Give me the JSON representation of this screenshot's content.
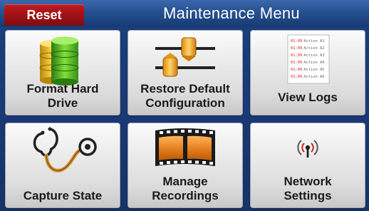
{
  "header": {
    "reset_label": "Reset",
    "title": "Maintenance Menu"
  },
  "tiles": [
    {
      "label_lines": [
        "Format Hard",
        "Drive"
      ],
      "icon": "database-icon"
    },
    {
      "label_lines": [
        "Restore Default",
        "Configuration"
      ],
      "icon": "sliders-icon"
    },
    {
      "label_lines": [
        "View Logs"
      ],
      "icon": "log-document-icon"
    },
    {
      "label_lines": [
        "Capture State"
      ],
      "icon": "stethoscope-icon"
    },
    {
      "label_lines": [
        "Manage",
        "Recordings"
      ],
      "icon": "film-strip-icon"
    },
    {
      "label_lines": [
        "Network",
        "Settings"
      ],
      "icon": "wireless-antenna-icon"
    }
  ],
  "log_lines": [
    {
      "time": "01:09",
      "text": "Action A1"
    },
    {
      "time": "01:09",
      "text": "Action A2"
    },
    {
      "time": "01:09",
      "text": "Action A3"
    },
    {
      "time": "01:09",
      "text": "Action A4"
    },
    {
      "time": "01:09",
      "text": "Action A5"
    },
    {
      "time": "01:09",
      "text": "Action A6"
    }
  ],
  "colors": {
    "header_bg": "#25508f",
    "reset_bg": "#9e1116",
    "page_bg": "#1a3a76",
    "tile_bg": "#e4e4e4",
    "log_time": "#cc2222"
  }
}
